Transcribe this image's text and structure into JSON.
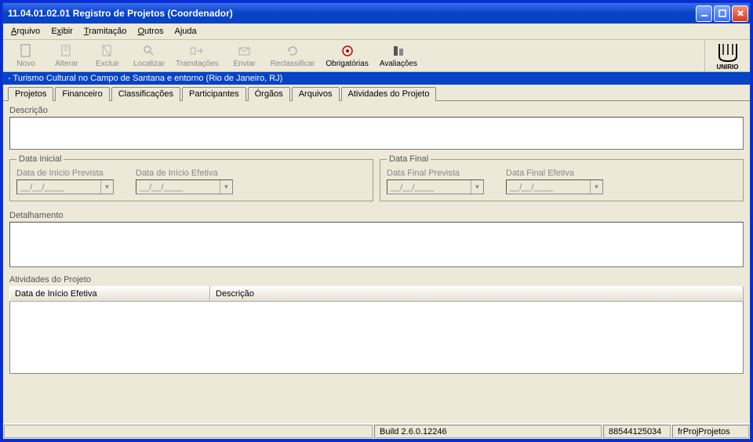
{
  "window": {
    "title": "11.04.01.02.01 Registro de Projetos (Coordenador)"
  },
  "menubar": [
    "Arquivo",
    "Exibir",
    "Tramitação",
    "Outros",
    "Ajuda"
  ],
  "toolbar": [
    {
      "label": "Novo",
      "enabled": false,
      "icon": "file"
    },
    {
      "label": "Alterar",
      "enabled": false,
      "icon": "edit"
    },
    {
      "label": "Excluir",
      "enabled": false,
      "icon": "delete"
    },
    {
      "label": "Localizar",
      "enabled": false,
      "icon": "search"
    },
    {
      "label": "Tramitações",
      "enabled": false,
      "icon": "flow"
    },
    {
      "label": "Enviar",
      "enabled": false,
      "icon": "send"
    },
    {
      "label": "Reclassificar",
      "enabled": false,
      "icon": "refresh"
    },
    {
      "label": "Obrigatórias",
      "enabled": true,
      "icon": "target"
    },
    {
      "label": "Avaliações",
      "enabled": true,
      "icon": "eval"
    }
  ],
  "logo_text": "UNIRIO",
  "context": " - Turismo Cultural no Campo de Santana e entorno (Rio de Janeiro, RJ)",
  "tabs": [
    "Projetos",
    "Financeiro",
    "Classificações",
    "Participantes",
    "Órgãos",
    "Arquivos",
    "Atividades do Projeto"
  ],
  "active_tab": "Atividades do Projeto",
  "fields": {
    "descricao_label": "Descrição",
    "data_inicial_legend": "Data Inicial",
    "data_final_legend": "Data Final",
    "data_inicio_prevista_label": "Data de Início Prevista",
    "data_inicio_efetiva_label": "Data de Início Efetiva",
    "data_final_prevista_label": "Data Final Prevista",
    "data_final_efetiva_label": "Data Final Efetiva",
    "date_mask": "__/__/____",
    "detalhamento_label": "Detalhamento",
    "atividades_legend": "Atividades do Projeto",
    "col_data_inicio": "Data de Início Efetiva",
    "col_descricao": "Descrição"
  },
  "statusbar": {
    "build": "Build 2.6.0.12246",
    "code": "88544125034",
    "form": "frProjProjetos"
  }
}
